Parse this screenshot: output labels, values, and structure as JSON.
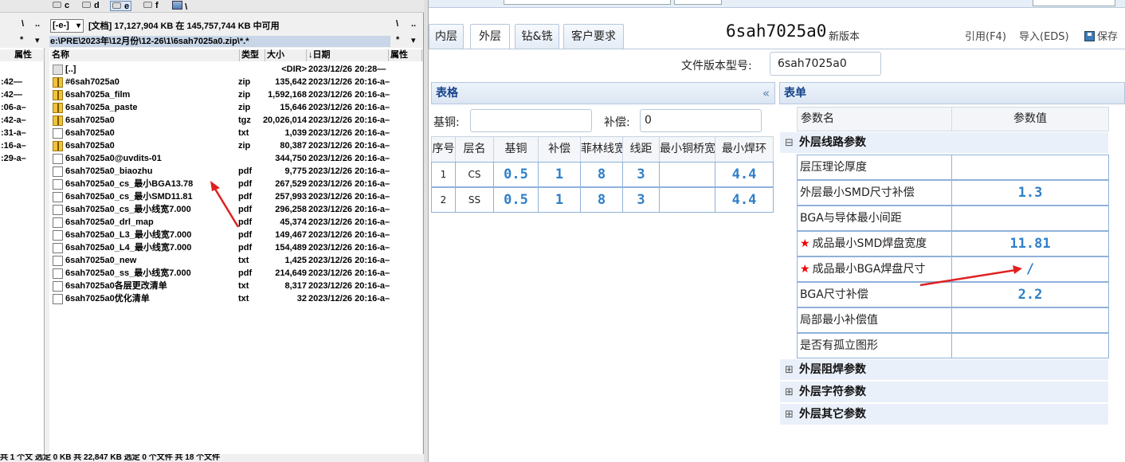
{
  "tc": {
    "drives": [
      {
        "label": "c",
        "selected": false
      },
      {
        "label": "d",
        "selected": false
      },
      {
        "label": "e",
        "selected": true
      },
      {
        "label": "f",
        "selected": false
      }
    ],
    "drive_root": "\\",
    "left_top": {
      "root": "\\",
      "up": "..",
      "star": "*",
      "down": "▾"
    },
    "combo_value": "[-e-]",
    "disk_info": "[文档]  17,127,904 KB 在 145,757,744 KB 中可用",
    "right_top": {
      "root": "\\",
      "up": "..",
      "star": "*",
      "down": "▾"
    },
    "path": "e:\\PRE\\2023年\\12月份\\12-26\\1\\6sah7025a0.zip\\*.*",
    "left_header": "属性",
    "columns": {
      "name": "名称",
      "ext": "类型",
      "size": "大小",
      "date": "↓日期",
      "attr": "属性"
    },
    "left_times": [
      ":42—",
      ":42—",
      ":06-a–",
      ":42-a–",
      ":31-a–",
      ":16-a–",
      ":29-a–"
    ],
    "files": [
      {
        "name": "[..]",
        "ext": "",
        "size": "<DIR>",
        "date": "2023/12/26 20:28—",
        "attr": "",
        "icon": "up"
      },
      {
        "name": "#6sah7025a0",
        "ext": "zip",
        "size": "135,642",
        "date": "2023/12/26 20:16-a–",
        "attr": "",
        "icon": "zip"
      },
      {
        "name": "6sah7025a_film",
        "ext": "zip",
        "size": "1,592,168",
        "date": "2023/12/26 20:16-a–",
        "attr": "",
        "icon": "zip"
      },
      {
        "name": "6sah7025a_paste",
        "ext": "zip",
        "size": "15,646",
        "date": "2023/12/26 20:16-a–",
        "attr": "",
        "icon": "zip"
      },
      {
        "name": "6sah7025a0",
        "ext": "tgz",
        "size": "20,026,014",
        "date": "2023/12/26 20:16-a–",
        "attr": "",
        "icon": "zip"
      },
      {
        "name": "6sah7025a0",
        "ext": "txt",
        "size": "1,039",
        "date": "2023/12/26 20:16-a–",
        "attr": "",
        "icon": "doc"
      },
      {
        "name": "6sah7025a0",
        "ext": "zip",
        "size": "80,387",
        "date": "2023/12/26 20:16-a–",
        "attr": "",
        "icon": "zip"
      },
      {
        "name": "6sah7025a0@uvdits-01",
        "ext": "",
        "size": "344,750",
        "date": "2023/12/26 20:16-a–",
        "attr": "",
        "icon": "doc"
      },
      {
        "name": "6sah7025a0_biaozhu",
        "ext": "pdf",
        "size": "9,775",
        "date": "2023/12/26 20:16-a–",
        "attr": "",
        "icon": "doc"
      },
      {
        "name": "6sah7025a0_cs_最小BGA13.78",
        "ext": "pdf",
        "size": "267,529",
        "date": "2023/12/26 20:16-a–",
        "attr": "",
        "icon": "doc"
      },
      {
        "name": "6sah7025a0_cs_最小SMD11.81",
        "ext": "pdf",
        "size": "257,993",
        "date": "2023/12/26 20:16-a–",
        "attr": "",
        "icon": "doc"
      },
      {
        "name": "6sah7025a0_cs_最小线宽7.000",
        "ext": "pdf",
        "size": "296,258",
        "date": "2023/12/26 20:16-a–",
        "attr": "",
        "icon": "doc"
      },
      {
        "name": "6sah7025a0_drl_map",
        "ext": "pdf",
        "size": "45,374",
        "date": "2023/12/26 20:16-a–",
        "attr": "",
        "icon": "doc"
      },
      {
        "name": "6sah7025a0_L3_最小线宽7.000",
        "ext": "pdf",
        "size": "149,467",
        "date": "2023/12/26 20:16-a–",
        "attr": "",
        "icon": "doc"
      },
      {
        "name": "6sah7025a0_L4_最小线宽7.000",
        "ext": "pdf",
        "size": "154,489",
        "date": "2023/12/26 20:16-a–",
        "attr": "",
        "icon": "doc"
      },
      {
        "name": "6sah7025a0_new",
        "ext": "txt",
        "size": "1,425",
        "date": "2023/12/26 20:16-a–",
        "attr": "",
        "icon": "doc"
      },
      {
        "name": "6sah7025a0_ss_最小线宽7.000",
        "ext": "pdf",
        "size": "214,649",
        "date": "2023/12/26 20:16-a–",
        "attr": "",
        "icon": "doc"
      },
      {
        "name": "6sah7025a0各层更改清单",
        "ext": "txt",
        "size": "8,317",
        "date": "2023/12/26 20:16-a–",
        "attr": "",
        "icon": "doc"
      },
      {
        "name": "6sah7025a0优化清单",
        "ext": "txt",
        "size": "32",
        "date": "2023/12/26 20:16-a–",
        "attr": "",
        "icon": "doc"
      }
    ],
    "status": "共 1 个文  选定 0 KB  共 22,847 KB  选定 0 个文件  共 18 个文件"
  },
  "app": {
    "tabs": [
      {
        "label": "内层",
        "active": false
      },
      {
        "label": "外层",
        "active": true
      },
      {
        "label": "钻&铣",
        "active": false
      },
      {
        "label": "客户要求",
        "active": false
      }
    ],
    "title": "6sah7025a0",
    "subtitle": "新版本",
    "toolbar": {
      "import_ref": "引用(F4)",
      "import_eds": "导入(EDS)",
      "save": "保存"
    },
    "version_label": "文件版本型号:",
    "version_value": "6sah7025a0",
    "table_panel": {
      "title": "表格",
      "collapse": "«",
      "base_copper_label": "基铜:",
      "base_copper_value": "",
      "comp_label": "补偿:",
      "comp_value": "0",
      "columns": [
        "序号",
        "层名",
        "基铜",
        "补偿",
        "菲林线宽",
        "线距",
        "最小铜桥宽",
        "最小焊环"
      ],
      "rows": [
        {
          "no": "1",
          "layer": "CS",
          "copper": "0.5",
          "comp": "1",
          "film_width": "8",
          "spacing": "3",
          "bridge": "",
          "ring": "4.4"
        },
        {
          "no": "2",
          "layer": "SS",
          "copper": "0.5",
          "comp": "1",
          "film_width": "8",
          "spacing": "3",
          "bridge": "",
          "ring": "4.4"
        }
      ]
    },
    "form_panel": {
      "title": "表单",
      "col_name": "参数名",
      "col_value": "参数值",
      "groups": [
        {
          "label": "外层线路参数",
          "expanded": true,
          "expand_icon": "⊟"
        },
        {
          "label": "外层阻焊参数",
          "expanded": false,
          "expand_icon": "⊞"
        },
        {
          "label": "外层字符参数",
          "expanded": false,
          "expand_icon": "⊞"
        },
        {
          "label": "外层其它参数",
          "expanded": false,
          "expand_icon": "⊞"
        }
      ],
      "params": [
        {
          "name": "层压理论厚度",
          "value": "",
          "required": false
        },
        {
          "name": "外层最小SMD尺寸补偿",
          "value": "1.3",
          "required": false
        },
        {
          "name": "BGA与导体最小间距",
          "value": "",
          "required": false
        },
        {
          "name": "成品最小SMD焊盘宽度",
          "value": "11.81",
          "required": true
        },
        {
          "name": "成品最小BGA焊盘尺寸",
          "value": "/",
          "required": true
        },
        {
          "name": "BGA尺寸补偿",
          "value": "2.2",
          "required": false
        },
        {
          "name": "局部最小补偿值",
          "value": "",
          "required": false
        },
        {
          "name": "是否有孤立图形",
          "value": "",
          "required": false
        }
      ],
      "star": "★"
    }
  },
  "colors": {
    "accent_blue": "#2f7fc8",
    "required_star": "#e00000",
    "annotation_arrow": "#e02020",
    "panel_header": "#15428b"
  }
}
